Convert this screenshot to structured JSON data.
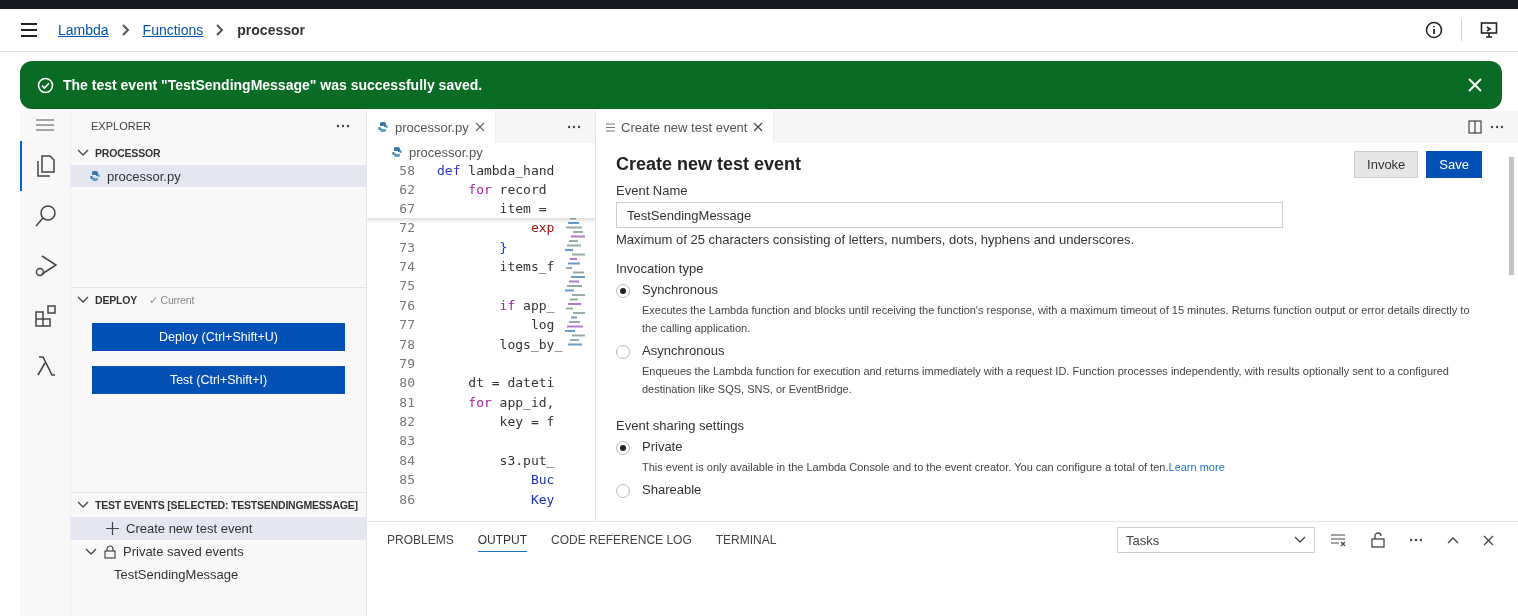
{
  "breadcrumb": [
    {
      "label": "Lambda",
      "kind": "link"
    },
    {
      "label": "Functions",
      "kind": "link"
    },
    {
      "label": "processor",
      "kind": "current"
    }
  ],
  "flash": {
    "message": "The test event \"TestSendingMessage\" was successfully saved."
  },
  "activity_bar": [
    {
      "kind": "files",
      "selected": true
    },
    {
      "kind": "search",
      "selected": false
    },
    {
      "kind": "debug",
      "selected": false
    },
    {
      "kind": "extensions",
      "selected": false
    },
    {
      "kind": "lambda",
      "selected": false
    }
  ],
  "explorer": {
    "title": "EXPLORER",
    "folder": {
      "name": "PROCESSOR",
      "expanded": true,
      "files": [
        {
          "name": "processor.py",
          "selected": true
        }
      ]
    }
  },
  "deploy": {
    "title": "DEPLOY",
    "status": "✓ Current",
    "expanded": true,
    "buttons": [
      "Deploy (Ctrl+Shift+U)",
      "Test (Ctrl+Shift+I)"
    ]
  },
  "test_events": {
    "title": "TEST EVENTS [SELECTED: TESTSENDINGMESSAGE]",
    "expanded": true,
    "items": [
      {
        "label": "Create new test event",
        "kind": "create",
        "selected": true
      },
      {
        "label": "Private saved events",
        "kind": "group",
        "selected": false,
        "expanded": true,
        "children": [
          {
            "label": "TestSendingMessage",
            "selected": false
          }
        ]
      }
    ]
  },
  "editor": {
    "tab": "processor.py",
    "breadcrumb": "processor.py",
    "sticky_lines": [
      {
        "number": "58",
        "tokens": [
          {
            "text": "def",
            "kind": "def"
          },
          {
            "text": " lambda_hand",
            "kind": "plain"
          }
        ]
      },
      {
        "number": "62",
        "tokens": [
          {
            "text": "    for",
            "kind": "keyword"
          },
          {
            "text": " record",
            "kind": "plain"
          }
        ]
      },
      {
        "number": "67",
        "tokens": [
          {
            "text": "        item =",
            "kind": "plain"
          }
        ]
      }
    ],
    "lines": [
      {
        "number": "72",
        "tokens": [
          {
            "text": "            exp",
            "kind": "string"
          }
        ]
      },
      {
        "number": "73",
        "tokens": [
          {
            "text": "        }",
            "kind": "brace"
          }
        ]
      },
      {
        "number": "74",
        "tokens": [
          {
            "text": "        items_f",
            "kind": "plain"
          }
        ]
      },
      {
        "number": "75"
      },
      {
        "number": "76",
        "tokens": [
          {
            "text": "        if",
            "kind": "keyword"
          },
          {
            "text": " app_",
            "kind": "plain"
          }
        ]
      },
      {
        "number": "77",
        "tokens": [
          {
            "text": "            log",
            "kind": "plain"
          }
        ]
      },
      {
        "number": "78",
        "tokens": [
          {
            "text": "        logs_by_",
            "kind": "plain"
          }
        ]
      },
      {
        "number": "79"
      },
      {
        "number": "80",
        "tokens": [
          {
            "text": "    dt = dateti",
            "kind": "plain"
          }
        ]
      },
      {
        "number": "81",
        "tokens": [
          {
            "text": "    for",
            "kind": "keyword"
          },
          {
            "text": " app_id,",
            "kind": "plain"
          }
        ]
      },
      {
        "number": "82",
        "tokens": [
          {
            "text": "        key = f",
            "kind": "plain"
          }
        ]
      },
      {
        "number": "83"
      },
      {
        "number": "84",
        "tokens": [
          {
            "text": "        s3.put_",
            "kind": "plain"
          }
        ]
      },
      {
        "number": "85",
        "tokens": [
          {
            "text": "            Buc",
            "kind": "param"
          }
        ]
      },
      {
        "number": "86",
        "tokens": [
          {
            "text": "            Key",
            "kind": "param"
          }
        ]
      }
    ]
  },
  "test_tab": {
    "title": "Create new test event"
  },
  "form": {
    "heading": "Create new test event",
    "buttons": [
      {
        "label": "Invoke",
        "kind": "secondary"
      },
      {
        "label": "Save",
        "kind": "primary"
      }
    ],
    "event_name": {
      "label": "Event Name",
      "value": "TestSendingMessage",
      "hint": "Maximum of 25 characters consisting of letters, numbers, dots, hyphens and underscores."
    },
    "invocation": {
      "label": "Invocation type",
      "options": [
        {
          "label": "Synchronous",
          "selected": true,
          "description": "Executes the Lambda function and blocks until receiving the function's response, with a maximum timeout of 15 minutes. Returns function output or error details directly to the calling application."
        },
        {
          "label": "Asynchronous",
          "selected": false,
          "description": "Enqueues the Lambda function for execution and returns immediately with a request ID. Function processes independently, with results optionally sent to a configured destination like SQS, SNS, or EventBridge."
        }
      ]
    },
    "sharing": {
      "label": "Event sharing settings",
      "options": [
        {
          "label": "Private",
          "selected": true,
          "description": "This event is only available in the Lambda Console and to the event creator. You can configure a total of ten.",
          "link": "Learn more"
        },
        {
          "label": "Shareable",
          "selected": false
        }
      ]
    }
  },
  "panel": {
    "tabs": [
      {
        "label": "PROBLEMS",
        "selected": false
      },
      {
        "label": "OUTPUT",
        "selected": true
      },
      {
        "label": "CODE REFERENCE LOG",
        "selected": false
      },
      {
        "label": "TERMINAL",
        "selected": false
      }
    ],
    "dropdown": "Tasks"
  }
}
